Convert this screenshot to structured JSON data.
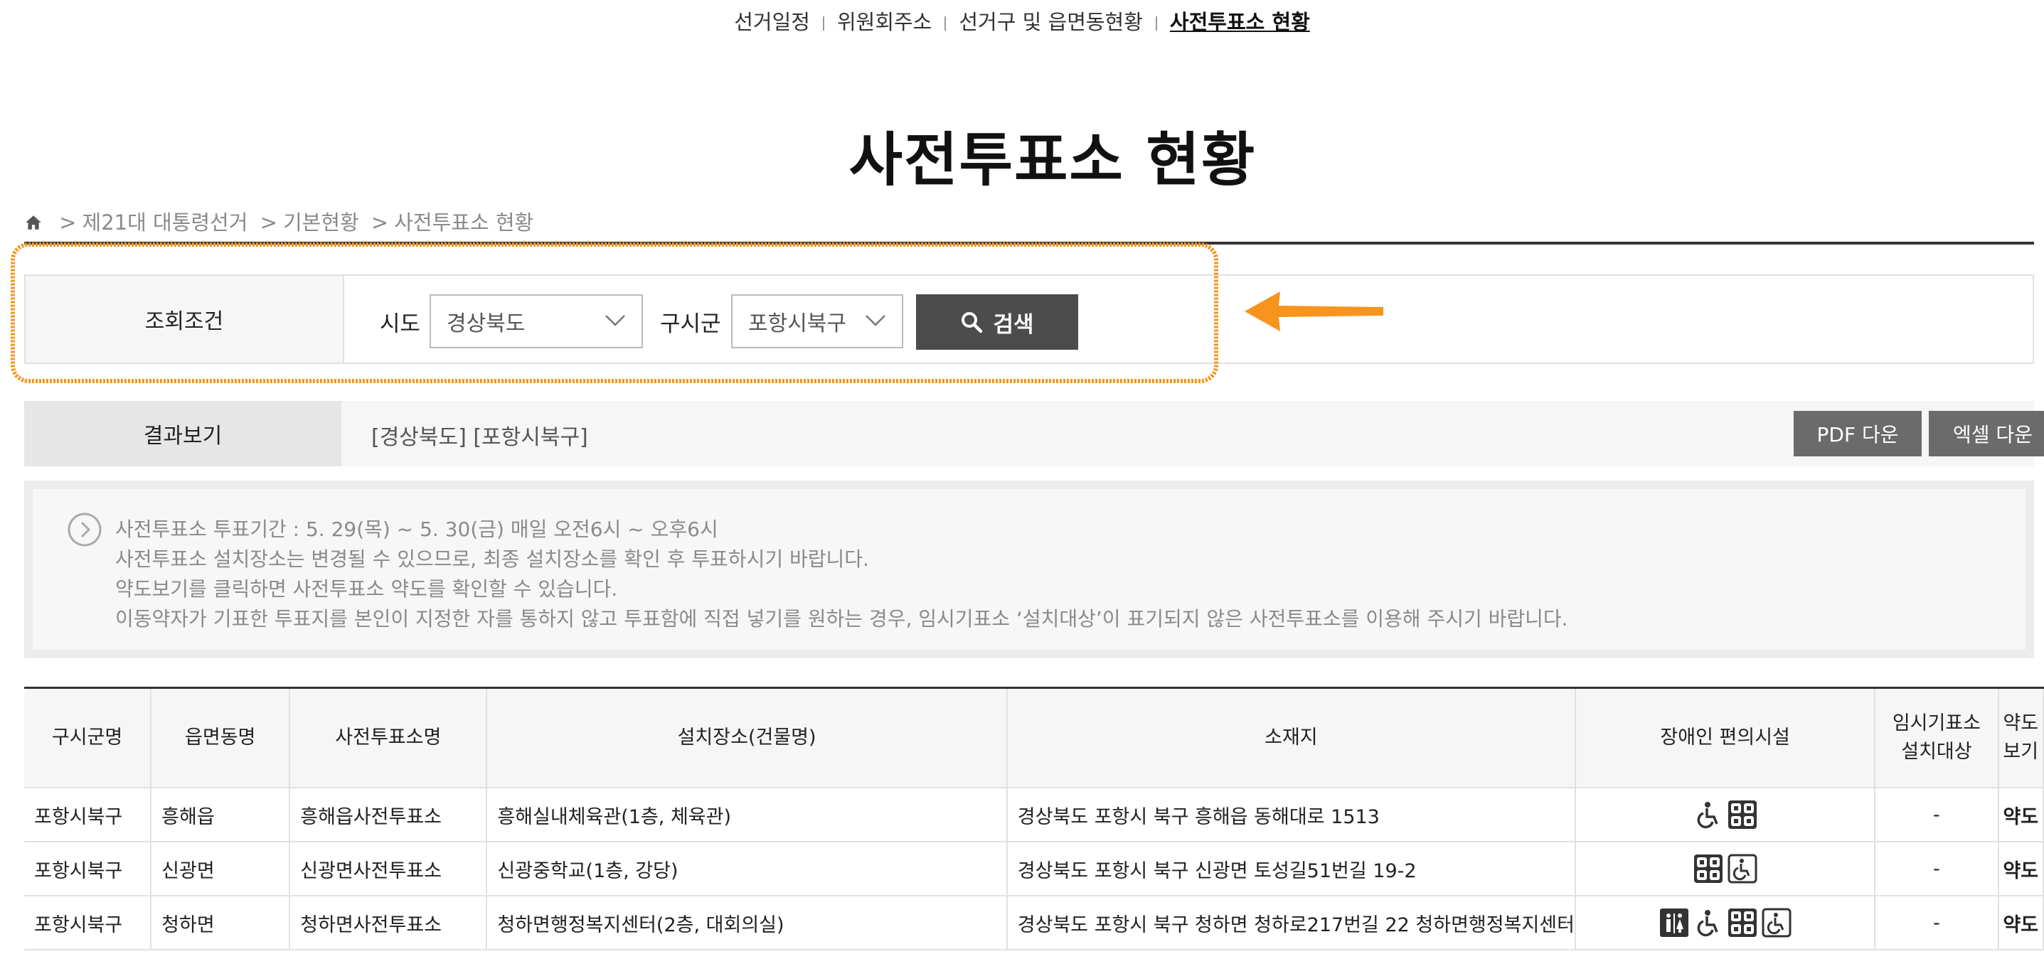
{
  "top_nav": {
    "items": [
      "선거일정",
      "위원회주소",
      "선거구 및 읍면동현황",
      "사전투표소 현황"
    ],
    "active_index": 3
  },
  "page_title": "사전투표소 현황",
  "breadcrumb": [
    "제21대 대통령선거",
    "기본현황",
    "사전투표소 현황"
  ],
  "search": {
    "label": "조회조건",
    "sido_label": "시도",
    "sido_value": "경상북도",
    "sigungu_label": "구시군",
    "sigungu_value": "포항시북구",
    "button_label": "검색"
  },
  "result": {
    "label": "결과보기",
    "value": "[경상북도] [포항시북구]",
    "pdf_button": "PDF 다운",
    "excel_button": "엑셀 다운"
  },
  "notice": [
    "사전투표소 투표기간 : 5. 29(목) ~ 5. 30(금) 매일 오전6시 ~ 오후6시",
    "사전투표소 설치장소는 변경될 수 있으므로, 최종 설치장소를 확인 후 투표하시기 바랍니다.",
    "약도보기를 클릭하면 사전투표소 약도를 확인할 수 있습니다.",
    "이동약자가 기표한 투표지를 본인이 지정한 자를 통하지 않고 투표함에 직접 넣기를 원하는 경우, 임시기표소 ‘설치대상’이 표기되지 않은 사전투표소를 이용해 주시기 바랍니다."
  ],
  "table": {
    "headers": [
      "구시군명",
      "읍면동명",
      "사전투표소명",
      "설치장소(건물명)",
      "소재지",
      "장애인 편의시설",
      "임시기표소\n설치대상",
      "약도\n보기"
    ],
    "rows": [
      {
        "gu": "포항시북구",
        "dong": "흥해읍",
        "name": "흥해읍사전투표소",
        "place": "흥해실내체육관(1층, 체육관)",
        "address": "경상북도 포항시 북구 흥해읍 동해대로 1513",
        "facilities": [
          "wheelchair-icon",
          "elevator-icon"
        ],
        "temp_booth": "-",
        "map": "약도"
      },
      {
        "gu": "포항시북구",
        "dong": "신광면",
        "name": "신광면사전투표소",
        "place": "신광중학교(1층, 강당)",
        "address": "경상북도 포항시 북구 신광면 토성길51번길 19-2",
        "facilities": [
          "elevator-icon",
          "wheelchair-access-icon"
        ],
        "temp_booth": "-",
        "map": "약도"
      },
      {
        "gu": "포항시북구",
        "dong": "청하면",
        "name": "청하면사전투표소",
        "place": "청하면행정복지센터(2층, 대회의실)",
        "address": "경상북도 포항시 북구 청하면 청하로217번길 22 청하면행정복지센터",
        "facilities": [
          "restroom-icon",
          "wheelchair-icon",
          "elevator-icon",
          "wheelchair-access-icon"
        ],
        "temp_booth": "-",
        "map": "약도"
      }
    ]
  },
  "colors": {
    "annotation": "#f7941d",
    "button_dark": "#4c4c4c",
    "button_gray": "#6b6b6b"
  }
}
